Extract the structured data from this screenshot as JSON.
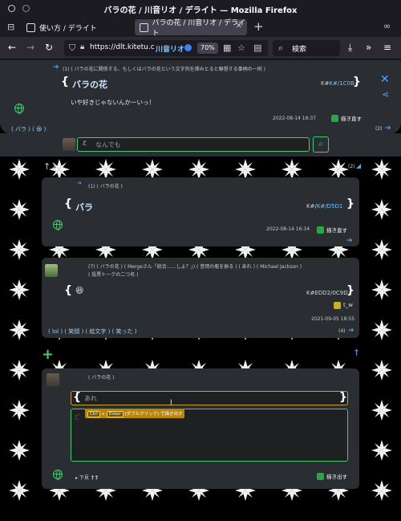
{
  "window": {
    "title": "バラの花 / 川音リオ / デライト — Mozilla Firefox",
    "tabs": [
      {
        "label": "使い方 / デライト"
      },
      {
        "label": "バラの花 / 川音リオ / デライト"
      }
    ]
  },
  "navbar": {
    "url": "https://dlt.kitetu.c",
    "url_user": "川音リオ",
    "zoom": "70%",
    "search_placeholder": "検索"
  },
  "top_post": {
    "breadcrumb": "(1) ( バラの花に関係する、もしくはバラの花という文字列を挿みとると聯想する事柄の一例 )",
    "title": "バラの花",
    "code": "K#/1C0B",
    "body": "いや好きじゃないんかーいっ！",
    "timestamp": "2022-08-14 16:37",
    "draw_button": "描き直す"
  },
  "tag_row": {
    "tags": "( バラ ) ( 😆 )",
    "count": "(2)"
  },
  "search": {
    "placeholder": "なんでも"
  },
  "arrows": {
    "up_down": "↑↓",
    "count": "(2)"
  },
  "card_bara": {
    "breadcrumb": "(1) ( バラの花 )",
    "title": "バラ",
    "code": "K#/D5D1",
    "timestamp": "2022-08-14 16:34",
    "draw_button": "描き直す"
  },
  "card_emoji": {
    "breadcrumb_1": "(7) ( バラの花 ) ( Mergeさん「統合……しよ？」) ( 昔岡の瓶を振る ) ( あれ ) ( Michael Jackson )",
    "breadcrumb_2": "( 投票トークの二つ名 )",
    "title": "😆",
    "code": "K#EDD2/0C9D",
    "author": "t_w",
    "timestamp": "2021-09-05 18:55",
    "tags": "( lol ) ( 笑顔 ) ( 絵文字 ) ( 笑った )",
    "count": "(4)"
  },
  "composer": {
    "breadcrumb": "( バラの花 )",
    "input_value": "あれ",
    "hint_key1": "Ctrl",
    "hint_key2": "Enter",
    "hint_text": "(ダブルクリック) で描き出す",
    "below_label": "▸ 下見 ❢❢",
    "draw_button": "描き出す"
  }
}
